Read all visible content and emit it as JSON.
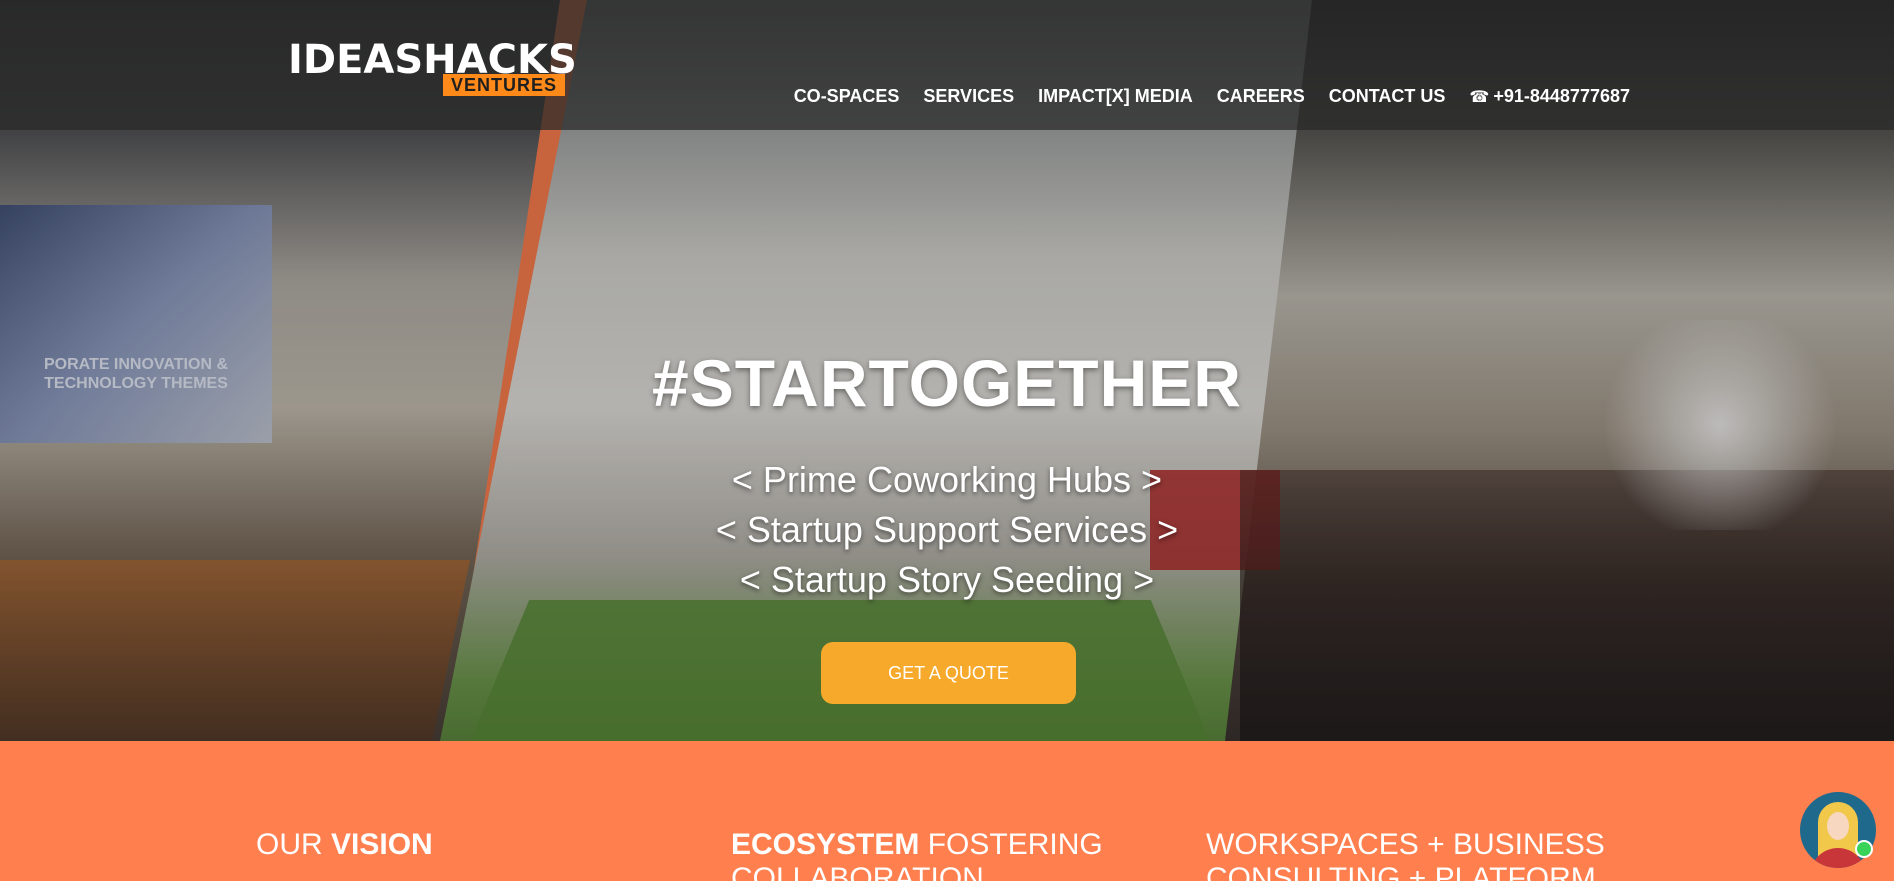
{
  "logo": {
    "main": "IDEASHACKS",
    "sub": "VENTURES"
  },
  "nav": {
    "items": [
      "CO-SPACES",
      "SERVICES",
      "IMPACT[X] MEDIA",
      "CAREERS",
      "CONTACT US"
    ],
    "phone": "+91-8448777687",
    "phone_icon": "phone-icon"
  },
  "hero": {
    "title": "#STARTOGETHER",
    "lines": [
      "< Prime Coworking Hubs >",
      "< Startup Support Services >",
      "< Startup Story Seeding >"
    ],
    "cta": "GET A QUOTE",
    "screen_text": "PORATE INNOVATION & TECHNOLOGY THEMES"
  },
  "sections": {
    "col1": {
      "prefix": "OUR ",
      "bold": "VISION",
      "suffix": ""
    },
    "col2": {
      "prefix": "",
      "bold": "ECOSYSTEM",
      "suffix": " FOSTERING COLLABORATION"
    },
    "col3": {
      "prefix": "WORKSPACES + BUSINESS CONSULTING + PLATFORM",
      "bold": "",
      "suffix": ""
    }
  },
  "chat": {
    "icon": "chat-avatar-icon"
  },
  "colors": {
    "accent": "#ff7f4f",
    "cta": "#f6a92b",
    "logo_sub_bg": "#ff8a1a"
  }
}
